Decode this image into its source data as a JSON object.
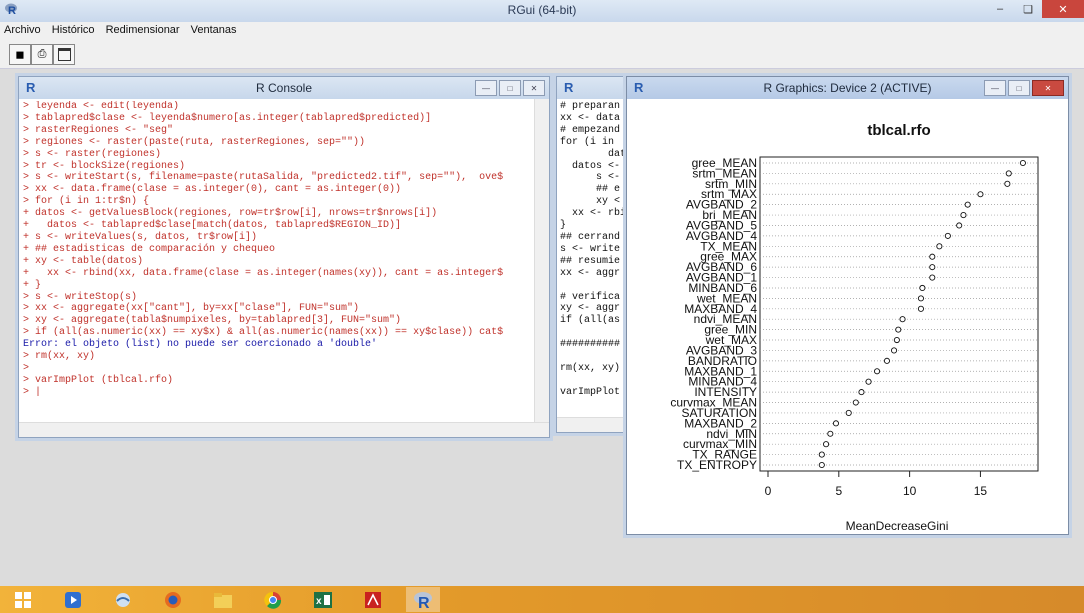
{
  "app": {
    "title": "RGui (64-bit)",
    "menu": [
      "Archivo",
      "Histórico",
      "Redimensionar",
      "Ventanas"
    ]
  },
  "console": {
    "title": "R Console",
    "lines": [
      "> leyenda <- edit(leyenda)",
      "> tablapred$clase <- leyenda$numero[as.integer(tablapred$predicted)]",
      "> rasterRegiones <- \"seg\"",
      "> regiones <- raster(paste(ruta, rasterRegiones, sep=\"\"))",
      "> s <- raster(regiones)",
      "> tr <- blockSize(regiones)",
      "> s <- writeStart(s, filename=paste(rutaSalida, \"predicted2.tif\", sep=\"\"),  ove$",
      "> xx <- data.frame(clase = as.integer(0), cant = as.integer(0))",
      "> for (i in 1:tr$n) {",
      "+ datos <- getValuesBlock(regiones, row=tr$row[i], nrows=tr$nrows[i])",
      "+   datos <- tablapred$clase[match(datos, tablapred$REGION_ID)]",
      "+ s <- writeValues(s, datos, tr$row[i])",
      "+ ## estadisticas de comparación y chequeo",
      "+ xy <- table(datos)",
      "+   xx <- rbind(xx, data.frame(clase = as.integer(names(xy)), cant = as.integer$",
      "+ }",
      "> s <- writeStop(s)",
      "> xx <- aggregate(xx[\"cant\"], by=xx[\"clase\"], FUN=\"sum\")",
      "> xy <- aggregate(tabla$numpixeles, by=tablapred[3], FUN=\"sum\")",
      "> if (all(as.numeric(xx) == xy$x) & all(as.numeric(names(xx)) == xy$clase)) cat$",
      "Error: el objeto (list) no puede ser coercionado a 'double'",
      "> rm(xx, xy)",
      ">",
      "> varImpPlot (tblcal.rfo)",
      "> |"
    ]
  },
  "editor": {
    "lines": [
      "# preparan",
      "xx <- data",
      "# empezand",
      "for (i in ",
      "        dato",
      "  datos <-",
      "      s <-",
      "      ## e",
      "      xy <",
      "  xx <- rbi",
      "}",
      "## cerrand",
      "s <- write",
      "## resumie",
      "xx <- aggr",
      "",
      "# verifica",
      "xy <- aggr",
      "if (all(as",
      "",
      "##########",
      "",
      "rm(xx, xy)",
      "",
      "varImpPlot"
    ]
  },
  "graphics": {
    "title": "R Graphics: Device 2 (ACTIVE)"
  },
  "chart_data": {
    "type": "scatter",
    "title": "tblcal.rfo",
    "xlabel": "MeanDecreaseGini",
    "ylabel": "",
    "xlim": [
      0,
      18.5
    ],
    "xticks": [
      0,
      5,
      10,
      15
    ],
    "grid": "dotted horizontal",
    "categories": [
      "gree_MEAN",
      "srtm_MEAN",
      "srtm_MIN",
      "srtm_MAX",
      "AVGBAND_2",
      "bri_MEAN",
      "AVGBAND_5",
      "AVGBAND_4",
      "TX_MEAN",
      "gree_MAX",
      "AVGBAND_6",
      "AVGBAND_1",
      "MINBAND_6",
      "wet_MEAN",
      "MAXBAND_4",
      "ndvi_MEAN",
      "gree_MIN",
      "wet_MAX",
      "AVGBAND_3",
      "BANDRATIO",
      "MAXBAND_1",
      "MINBAND_4",
      "INTENSITY",
      "curvmax_MEAN",
      "SATURATION",
      "MAXBAND_2",
      "ndvi_MIN",
      "curvmax_MIN",
      "TX_RANGE",
      "TX_ENTROPY"
    ],
    "values": [
      18.0,
      17.0,
      16.9,
      15.0,
      14.1,
      13.8,
      13.5,
      12.7,
      12.1,
      11.6,
      11.6,
      11.6,
      10.9,
      10.8,
      10.8,
      9.5,
      9.2,
      9.1,
      8.9,
      8.4,
      7.7,
      7.1,
      6.6,
      6.2,
      5.7,
      4.8,
      4.4,
      4.1,
      3.8,
      3.8
    ]
  },
  "taskbar": {
    "icons": [
      "windows-start-icon",
      "media-player-icon",
      "sea-app-icon",
      "firefox-icon",
      "file-explorer-icon",
      "chrome-icon",
      "excel-icon",
      "acrobat-icon",
      "r-app-icon"
    ]
  }
}
